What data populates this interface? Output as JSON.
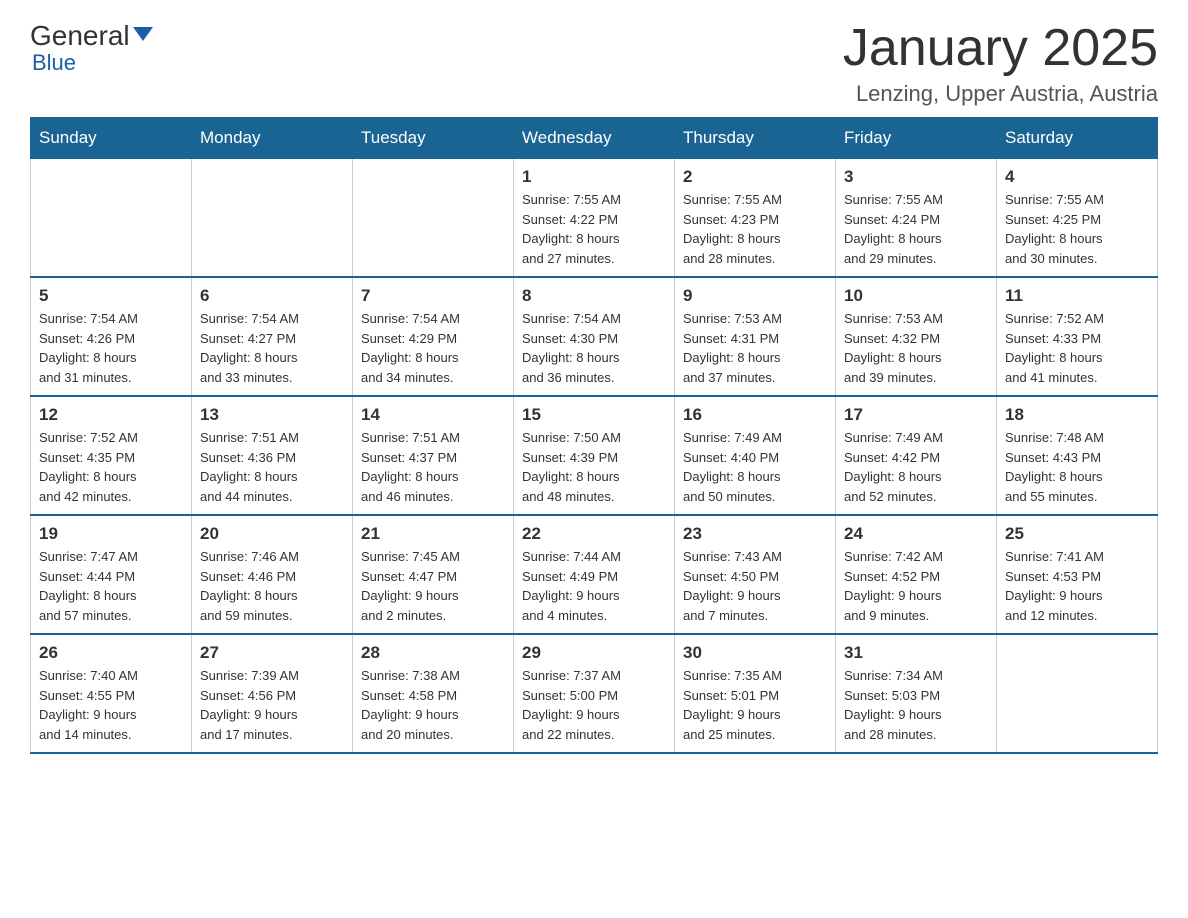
{
  "logo": {
    "general": "General",
    "blue": "Blue",
    "subtitle": "Blue"
  },
  "header": {
    "month_year": "January 2025",
    "location": "Lenzing, Upper Austria, Austria"
  },
  "days_of_week": [
    "Sunday",
    "Monday",
    "Tuesday",
    "Wednesday",
    "Thursday",
    "Friday",
    "Saturday"
  ],
  "weeks": [
    [
      {
        "day": "",
        "info": ""
      },
      {
        "day": "",
        "info": ""
      },
      {
        "day": "",
        "info": ""
      },
      {
        "day": "1",
        "info": "Sunrise: 7:55 AM\nSunset: 4:22 PM\nDaylight: 8 hours\nand 27 minutes."
      },
      {
        "day": "2",
        "info": "Sunrise: 7:55 AM\nSunset: 4:23 PM\nDaylight: 8 hours\nand 28 minutes."
      },
      {
        "day": "3",
        "info": "Sunrise: 7:55 AM\nSunset: 4:24 PM\nDaylight: 8 hours\nand 29 minutes."
      },
      {
        "day": "4",
        "info": "Sunrise: 7:55 AM\nSunset: 4:25 PM\nDaylight: 8 hours\nand 30 minutes."
      }
    ],
    [
      {
        "day": "5",
        "info": "Sunrise: 7:54 AM\nSunset: 4:26 PM\nDaylight: 8 hours\nand 31 minutes."
      },
      {
        "day": "6",
        "info": "Sunrise: 7:54 AM\nSunset: 4:27 PM\nDaylight: 8 hours\nand 33 minutes."
      },
      {
        "day": "7",
        "info": "Sunrise: 7:54 AM\nSunset: 4:29 PM\nDaylight: 8 hours\nand 34 minutes."
      },
      {
        "day": "8",
        "info": "Sunrise: 7:54 AM\nSunset: 4:30 PM\nDaylight: 8 hours\nand 36 minutes."
      },
      {
        "day": "9",
        "info": "Sunrise: 7:53 AM\nSunset: 4:31 PM\nDaylight: 8 hours\nand 37 minutes."
      },
      {
        "day": "10",
        "info": "Sunrise: 7:53 AM\nSunset: 4:32 PM\nDaylight: 8 hours\nand 39 minutes."
      },
      {
        "day": "11",
        "info": "Sunrise: 7:52 AM\nSunset: 4:33 PM\nDaylight: 8 hours\nand 41 minutes."
      }
    ],
    [
      {
        "day": "12",
        "info": "Sunrise: 7:52 AM\nSunset: 4:35 PM\nDaylight: 8 hours\nand 42 minutes."
      },
      {
        "day": "13",
        "info": "Sunrise: 7:51 AM\nSunset: 4:36 PM\nDaylight: 8 hours\nand 44 minutes."
      },
      {
        "day": "14",
        "info": "Sunrise: 7:51 AM\nSunset: 4:37 PM\nDaylight: 8 hours\nand 46 minutes."
      },
      {
        "day": "15",
        "info": "Sunrise: 7:50 AM\nSunset: 4:39 PM\nDaylight: 8 hours\nand 48 minutes."
      },
      {
        "day": "16",
        "info": "Sunrise: 7:49 AM\nSunset: 4:40 PM\nDaylight: 8 hours\nand 50 minutes."
      },
      {
        "day": "17",
        "info": "Sunrise: 7:49 AM\nSunset: 4:42 PM\nDaylight: 8 hours\nand 52 minutes."
      },
      {
        "day": "18",
        "info": "Sunrise: 7:48 AM\nSunset: 4:43 PM\nDaylight: 8 hours\nand 55 minutes."
      }
    ],
    [
      {
        "day": "19",
        "info": "Sunrise: 7:47 AM\nSunset: 4:44 PM\nDaylight: 8 hours\nand 57 minutes."
      },
      {
        "day": "20",
        "info": "Sunrise: 7:46 AM\nSunset: 4:46 PM\nDaylight: 8 hours\nand 59 minutes."
      },
      {
        "day": "21",
        "info": "Sunrise: 7:45 AM\nSunset: 4:47 PM\nDaylight: 9 hours\nand 2 minutes."
      },
      {
        "day": "22",
        "info": "Sunrise: 7:44 AM\nSunset: 4:49 PM\nDaylight: 9 hours\nand 4 minutes."
      },
      {
        "day": "23",
        "info": "Sunrise: 7:43 AM\nSunset: 4:50 PM\nDaylight: 9 hours\nand 7 minutes."
      },
      {
        "day": "24",
        "info": "Sunrise: 7:42 AM\nSunset: 4:52 PM\nDaylight: 9 hours\nand 9 minutes."
      },
      {
        "day": "25",
        "info": "Sunrise: 7:41 AM\nSunset: 4:53 PM\nDaylight: 9 hours\nand 12 minutes."
      }
    ],
    [
      {
        "day": "26",
        "info": "Sunrise: 7:40 AM\nSunset: 4:55 PM\nDaylight: 9 hours\nand 14 minutes."
      },
      {
        "day": "27",
        "info": "Sunrise: 7:39 AM\nSunset: 4:56 PM\nDaylight: 9 hours\nand 17 minutes."
      },
      {
        "day": "28",
        "info": "Sunrise: 7:38 AM\nSunset: 4:58 PM\nDaylight: 9 hours\nand 20 minutes."
      },
      {
        "day": "29",
        "info": "Sunrise: 7:37 AM\nSunset: 5:00 PM\nDaylight: 9 hours\nand 22 minutes."
      },
      {
        "day": "30",
        "info": "Sunrise: 7:35 AM\nSunset: 5:01 PM\nDaylight: 9 hours\nand 25 minutes."
      },
      {
        "day": "31",
        "info": "Sunrise: 7:34 AM\nSunset: 5:03 PM\nDaylight: 9 hours\nand 28 minutes."
      },
      {
        "day": "",
        "info": ""
      }
    ]
  ]
}
